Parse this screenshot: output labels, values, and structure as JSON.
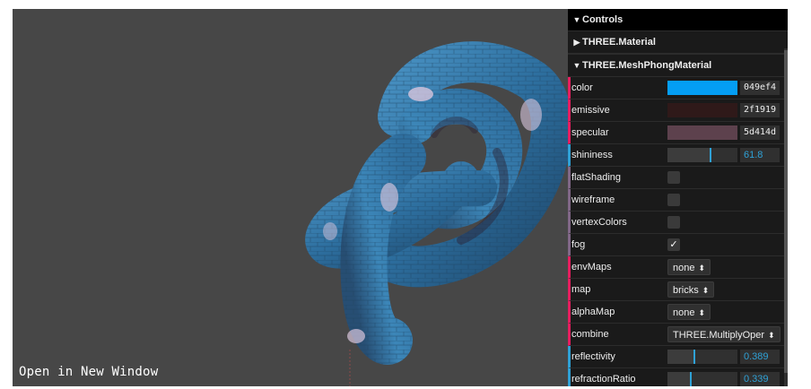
{
  "viewport": {
    "open_link": "Open in New Window"
  },
  "controls": {
    "title": "Controls",
    "folders": [
      {
        "label": "THREE.Material",
        "collapsed": true
      },
      {
        "label": "THREE.MeshPhongMaterial",
        "collapsed": false
      }
    ],
    "color": {
      "label": "color",
      "value": "049ef4",
      "swatch": "#049ef4"
    },
    "emissive": {
      "label": "emissive",
      "value": "2f1919",
      "swatch": "#2f1919"
    },
    "specular": {
      "label": "specular",
      "value": "5d414d",
      "swatch": "#5d414d"
    },
    "shininess": {
      "label": "shininess",
      "value": "61.8",
      "fraction": 0.62
    },
    "flatShading": {
      "label": "flatShading",
      "checked": false
    },
    "wireframe": {
      "label": "wireframe",
      "checked": false
    },
    "vertexColors": {
      "label": "vertexColors",
      "checked": false
    },
    "fog": {
      "label": "fog",
      "checked": true,
      "checkmark": "✓"
    },
    "envMaps": {
      "label": "envMaps",
      "value": "none"
    },
    "map": {
      "label": "map",
      "value": "bricks"
    },
    "alphaMap": {
      "label": "alphaMap",
      "value": "none"
    },
    "combine": {
      "label": "combine",
      "value": "THREE.MultiplyOper"
    },
    "reflectivity": {
      "label": "reflectivity",
      "value": "0.389",
      "fraction": 0.389
    },
    "refractionRatio": {
      "label": "refractionRatio",
      "value": "0.339",
      "fraction": 0.339
    }
  },
  "icons": {
    "collapsed": "▶",
    "expanded": "▼",
    "caret": "⬍"
  },
  "colors": {
    "viewport_bg": "#474747",
    "knot_base": "#3b7fb0",
    "knot_dark": "#2a2133",
    "knot_highlight": "#d8c6dd"
  }
}
